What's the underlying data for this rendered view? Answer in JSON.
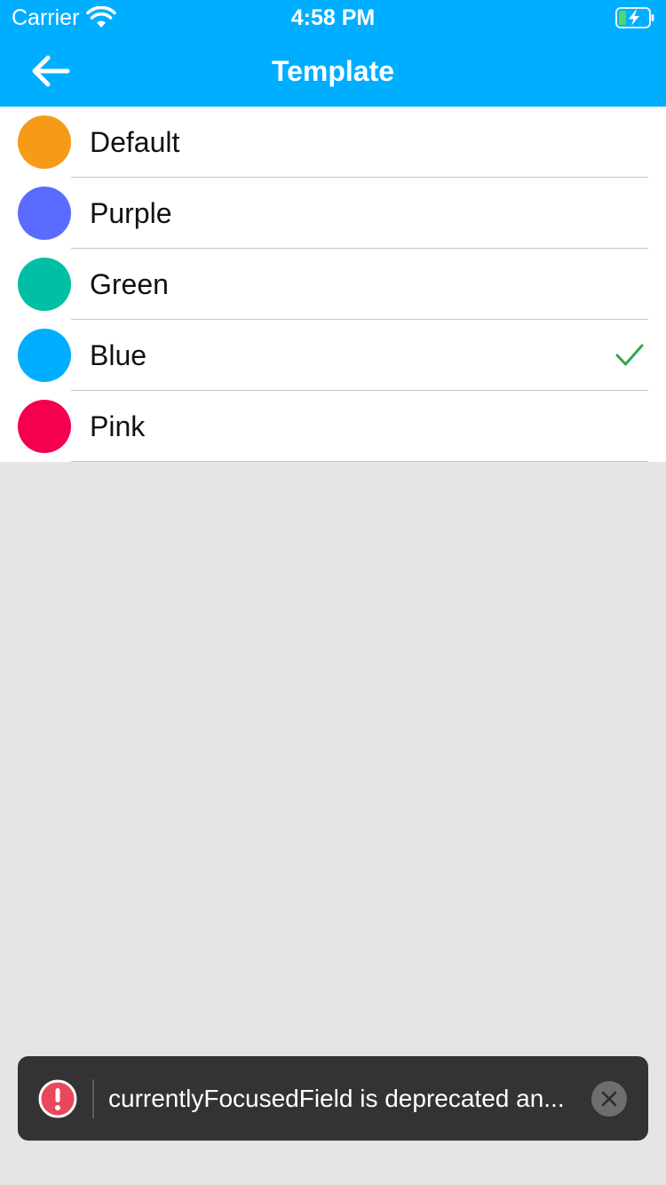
{
  "status_bar": {
    "carrier": "Carrier",
    "time": "4:58 PM"
  },
  "nav": {
    "title": "Template",
    "back_icon": "arrow-left-icon"
  },
  "templates": [
    {
      "label": "Default",
      "color": "#f59b17",
      "selected": false
    },
    {
      "label": "Purple",
      "color": "#5a6cff",
      "selected": false
    },
    {
      "label": "Green",
      "color": "#00bfa5",
      "selected": false
    },
    {
      "label": "Blue",
      "color": "#00aeff",
      "selected": true
    },
    {
      "label": "Pink",
      "color": "#f5004f",
      "selected": false
    }
  ],
  "toast": {
    "message": "currentlyFocusedField is deprecated an...",
    "icon": "error-icon",
    "close_icon": "close-icon"
  },
  "colors": {
    "header": "#00aeff",
    "check": "#2ea84a",
    "background": "#e5e5e5"
  }
}
